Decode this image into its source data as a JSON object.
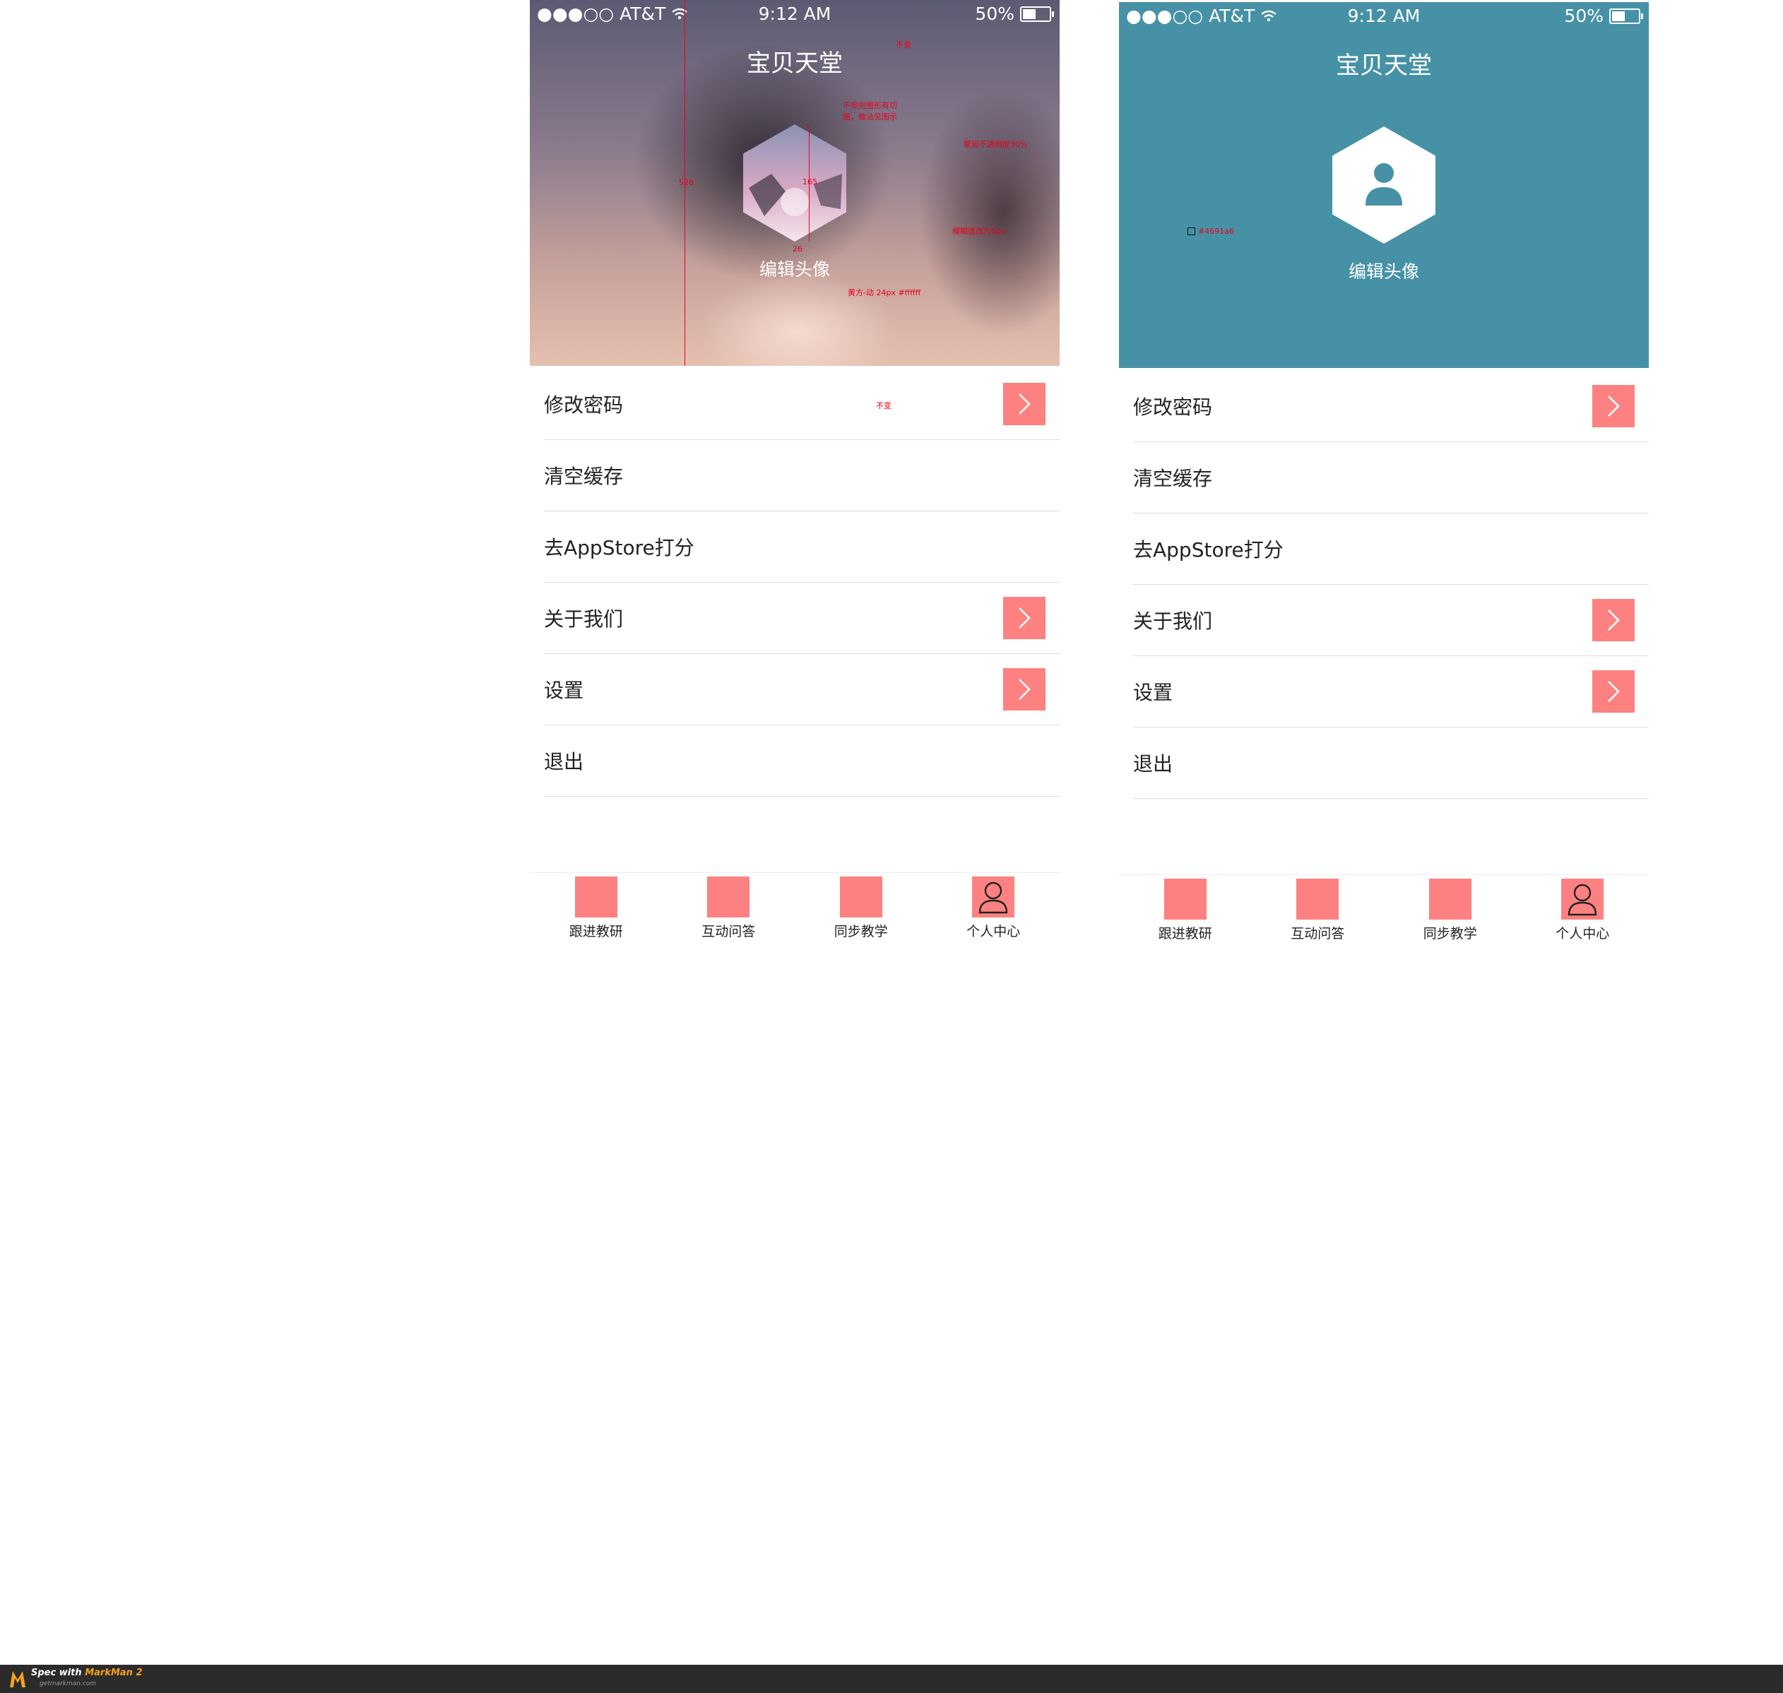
{
  "status_bar": {
    "signal": "●●●○○",
    "carrier": "AT&T",
    "time": "9:12 AM",
    "battery": "50%",
    "battery_level": 0.5
  },
  "header": {
    "title": "宝贝天堂",
    "edit_avatar": "编辑头像",
    "background_color": "#4691a6"
  },
  "annotations": {
    "title_note": "不变",
    "avatar_note": "不规则图形有切图，做法见图示",
    "opacity_note": "蒙层不透明度30%",
    "blur_note": "模糊值改为5px",
    "text_note": "黄方-动 24px #ffffff",
    "menu_note": "不变",
    "header_height": "528",
    "avatar_height": "165",
    "avatar_gap": "26",
    "color_note": "#4691a6"
  },
  "menu": [
    {
      "label": "修改密码",
      "has_arrow": true
    },
    {
      "label": "清空缓存",
      "has_arrow": false
    },
    {
      "label": "去AppStore打分",
      "has_arrow": false
    },
    {
      "label": "关于我们",
      "has_arrow": true
    },
    {
      "label": "设置",
      "has_arrow": true
    },
    {
      "label": "退出",
      "has_arrow": false
    }
  ],
  "tabs": [
    {
      "label": "跟进教研",
      "icon": "none"
    },
    {
      "label": "互动问答",
      "icon": "none"
    },
    {
      "label": "同步教学",
      "icon": "none"
    },
    {
      "label": "个人中心",
      "icon": "user-icon"
    }
  ],
  "accent_color": "#fd8180",
  "footer": {
    "brand_prefix": "Spec with ",
    "brand_name": "MarkMan 2",
    "brand_url": "getmarkman.com"
  }
}
